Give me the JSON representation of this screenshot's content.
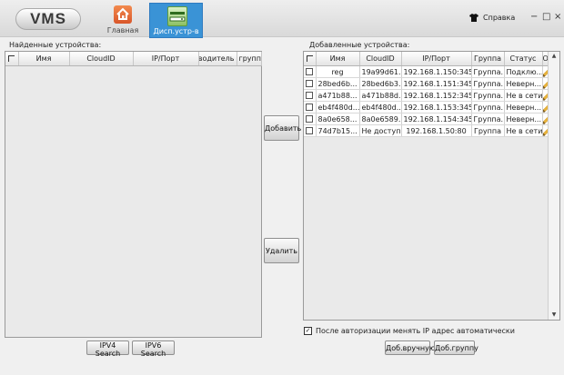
{
  "app": {
    "logo": "VMS"
  },
  "nav": [
    {
      "label": "Главная",
      "icon": "home-icon"
    },
    {
      "label": "Дисп.устр-в",
      "icon": "device-manager-icon"
    }
  ],
  "header": {
    "help_label": "Справка",
    "minimize_glyph": "−",
    "maximize_glyph": "□",
    "close_glyph": "×"
  },
  "found": {
    "title": "Найденные устройства:",
    "columns": [
      "Имя",
      "CloudID",
      "IP/Порт",
      "производитель",
      "группа"
    ]
  },
  "middle": {
    "add_label": "Добавить",
    "delete_label": "Удалить"
  },
  "added": {
    "title": "Добавленные устройства:",
    "columns": [
      "Имя",
      "CloudID",
      "IP/Порт",
      "Группа",
      "Статус",
      "Опер"
    ],
    "rows": [
      [
        "reg",
        "19a99d61...",
        "192.168.1.150:345...",
        "Группа...",
        "Подклю..."
      ],
      [
        "28bed6b...",
        "28bed6b3...",
        "192.168.1.151:345...",
        "Группа...",
        "Неверн..."
      ],
      [
        "a471b88...",
        "a471b88d...",
        "192.168.1.152:345...",
        "Группа...",
        "Не в сети"
      ],
      [
        "eb4f480d...",
        "eb4f480d...",
        "192.168.1.153:345...",
        "Группа...",
        "Неверн..."
      ],
      [
        "8a0e658...",
        "8a0e6589...",
        "192.168.1.154:345...",
        "Группа...",
        "Неверн..."
      ],
      [
        "74d7b15...",
        "Не доступ...",
        "192.168.1.50:80",
        "Группа",
        "Не в сети"
      ]
    ]
  },
  "footer": {
    "ipv4_label": "IPV4 Search",
    "ipv6_label": "IPV6 Search",
    "auto_ip_label": "После авторизации менять IP адрес автоматически",
    "auto_ip_checked": true,
    "manual_add_label": "Доб.вручную",
    "add_group_label": "Доб.группу"
  }
}
